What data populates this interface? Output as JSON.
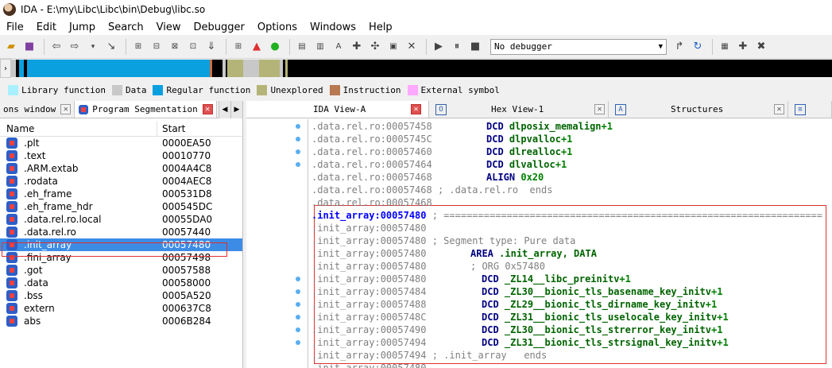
{
  "window": {
    "title": "IDA - E:\\my\\Libc\\Libc\\bin\\Debug\\libc.so"
  },
  "menu": [
    "File",
    "Edit",
    "Jump",
    "Search",
    "View",
    "Debugger",
    "Options",
    "Windows",
    "Help"
  ],
  "toolbar": {
    "debugger_value": "No debugger"
  },
  "legend": [
    {
      "label": "Library function",
      "color": "#a8f0ff"
    },
    {
      "label": "Data",
      "color": "#c8c8c8"
    },
    {
      "label": "Regular function",
      "color": "#0aa0e0"
    },
    {
      "label": "Unexplored",
      "color": "#b4b478"
    },
    {
      "label": "Instruction",
      "color": "#b87850"
    },
    {
      "label": "External symbol",
      "color": "#ffa8ff"
    }
  ],
  "left_tabs": {
    "tab1": "ons window",
    "tab2": "Program Segmentation"
  },
  "segments": {
    "header": {
      "name": "Name",
      "start": "Start"
    },
    "rows": [
      {
        "name": ".plt",
        "start": "0000EA50"
      },
      {
        "name": ".text",
        "start": "00010770"
      },
      {
        "name": ".ARM.extab",
        "start": "0004A4C8"
      },
      {
        "name": ".rodata",
        "start": "0004AEC8"
      },
      {
        "name": ".eh_frame",
        "start": "000531D8"
      },
      {
        "name": ".eh_frame_hdr",
        "start": "000545DC"
      },
      {
        "name": ".data.rel.ro.local",
        "start": "00055DA0"
      },
      {
        "name": ".data.rel.ro",
        "start": "00057440"
      },
      {
        "name": ".init_array",
        "start": "00057480"
      },
      {
        "name": ".fini_array",
        "start": "00057498"
      },
      {
        "name": ".got",
        "start": "00057588"
      },
      {
        "name": ".data",
        "start": "00058000"
      },
      {
        "name": ".bss",
        "start": "0005A520"
      },
      {
        "name": "extern",
        "start": "000637C8"
      },
      {
        "name": "abs",
        "start": "0006B284"
      }
    ]
  },
  "right_tabs": {
    "ida_view": "IDA View-A",
    "hex_view": "Hex View-1",
    "structures": "Structures",
    "hex_icon": "O",
    "struct_icon": "A"
  },
  "code": {
    "lines": [
      {
        "addr": ".data.rel.ro:00057458",
        "rest": "",
        "op": "DCD",
        "arg": "dlposix_memalign",
        "num": "+1",
        "dot": true
      },
      {
        "addr": ".data.rel.ro:0005745C",
        "rest": "",
        "op": "DCD",
        "arg": "dlpvalloc",
        "num": "+1",
        "dot": true
      },
      {
        "addr": ".data.rel.ro:00057460",
        "rest": "",
        "op": "DCD",
        "arg": "dlrealloc",
        "num": "+1",
        "dot": true
      },
      {
        "addr": ".data.rel.ro:00057464",
        "rest": "",
        "op": "DCD",
        "arg": "dlvalloc",
        "num": "+1",
        "dot": true
      },
      {
        "addr": ".data.rel.ro:00057468",
        "rest": "",
        "op": "ALIGN",
        "arg": "",
        "num": "0x20",
        "dot": false
      },
      {
        "addr": ".data.rel.ro:00057468",
        "rest": " ; .data.rel.ro  ends",
        "op": "",
        "arg": "",
        "num": "",
        "dot": false
      },
      {
        "addr": ".data.rel.ro:00057468",
        "rest": "",
        "op": "",
        "arg": "",
        "num": "",
        "dot": false
      },
      {
        "addr": ".init_array:00057480",
        "rest": " ; ==================================================================",
        "op": "",
        "arg": "",
        "num": "",
        "dot": false,
        "hl": true
      },
      {
        "addr": ".init_array:00057480",
        "rest": "",
        "op": "",
        "arg": "",
        "num": "",
        "dot": false
      },
      {
        "addr": ".init_array:00057480",
        "rest": " ; Segment type: Pure data",
        "op": "",
        "arg": "",
        "num": "",
        "dot": false
      },
      {
        "addr": ".init_array:00057480",
        "rest": "",
        "op": "AREA",
        "arg": ".init_array, DATA",
        "num": "",
        "dot": false,
        "wide": true
      },
      {
        "addr": ".init_array:00057480",
        "rest": "",
        "op": "; ORG 0x57480",
        "arg": "",
        "num": "",
        "dot": false,
        "wide": true,
        "cmtop": true
      },
      {
        "addr": ".init_array:00057480",
        "rest": "",
        "op": "DCD",
        "arg": "_ZL14__libc_preinitv",
        "num": "+1",
        "dot": true
      },
      {
        "addr": ".init_array:00057484",
        "rest": "",
        "op": "DCD",
        "arg": "_ZL30__bionic_tls_basename_key_initv",
        "num": "+1",
        "dot": true
      },
      {
        "addr": ".init_array:00057488",
        "rest": "",
        "op": "DCD",
        "arg": "_ZL29__bionic_tls_dirname_key_initv",
        "num": "+1",
        "dot": true
      },
      {
        "addr": ".init_array:0005748C",
        "rest": "",
        "op": "DCD",
        "arg": "_ZL31__bionic_tls_uselocale_key_initv",
        "num": "+1",
        "dot": true
      },
      {
        "addr": ".init_array:00057490",
        "rest": "",
        "op": "DCD",
        "arg": "_ZL30__bionic_tls_strerror_key_initv",
        "num": "+1",
        "dot": true
      },
      {
        "addr": ".init_array:00057494",
        "rest": "",
        "op": "DCD",
        "arg": "_ZL31__bionic_tls_strsignal_key_initv",
        "num": "+1",
        "dot": true
      },
      {
        "addr": ".init_array:00057494",
        "rest": " ; .init_array   ends",
        "op": "",
        "arg": "",
        "num": "",
        "dot": false
      },
      {
        "addr": ".init_array:00057480",
        "rest": "",
        "op": "",
        "arg": "",
        "num": "",
        "dot": false
      }
    ]
  }
}
